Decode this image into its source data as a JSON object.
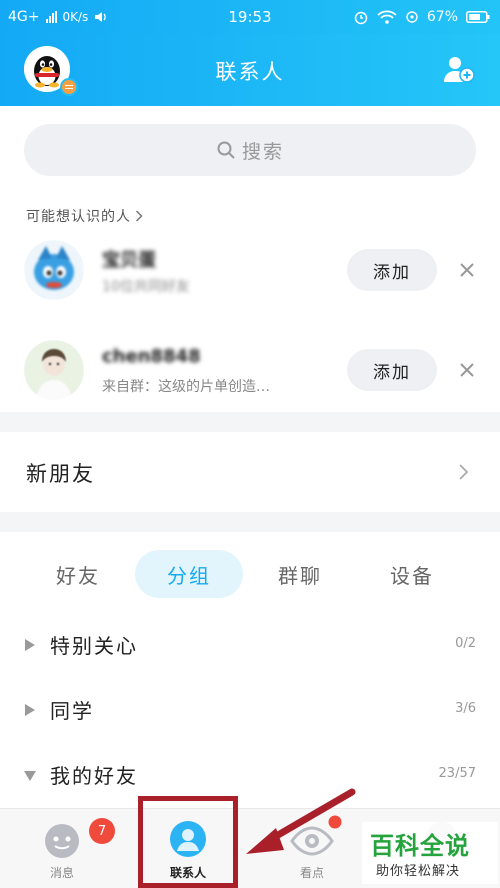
{
  "status_bar": {
    "network": "4G+",
    "speed": "0K/s",
    "time": "19:53",
    "battery": "67%"
  },
  "header": {
    "title": "联系人"
  },
  "search": {
    "placeholder": "搜索"
  },
  "suggestions": {
    "title": "可能想认识的人",
    "items": [
      {
        "name": "宝贝蛋",
        "desc": "10位共同好友",
        "desc_blurred": true,
        "add_label": "添加"
      },
      {
        "name": "chen8848",
        "desc": "来自群：这级的片单创造…",
        "desc_blurred": false,
        "add_label": "添加"
      }
    ]
  },
  "new_friends": {
    "label": "新朋友"
  },
  "tabs": [
    {
      "label": "好友",
      "active": false
    },
    {
      "label": "分组",
      "active": true
    },
    {
      "label": "群聊",
      "active": false
    },
    {
      "label": "设备",
      "active": false
    }
  ],
  "groups": [
    {
      "name": "特别关心",
      "count": "0/2",
      "expanded": false
    },
    {
      "name": "同学",
      "count": "3/6",
      "expanded": false
    },
    {
      "name": "我的好友",
      "count": "23/57",
      "expanded": true
    }
  ],
  "tabbar": {
    "items": [
      {
        "label": "消息",
        "icon": "message-icon",
        "badge": "7"
      },
      {
        "label": "联系人",
        "icon": "contacts-icon",
        "active": true
      },
      {
        "label": "看点",
        "icon": "eye-icon",
        "dot": true
      },
      {
        "label": "",
        "icon": "star-icon"
      }
    ]
  },
  "annotation": {
    "color": "#a9202b"
  },
  "watermark": {
    "logo": "百科全说",
    "sub": "助你轻松解决"
  },
  "colors": {
    "header": "#14a9f5",
    "accent": "#17a9ee",
    "badge": "#ef4a3c",
    "watermark": "#25a33d"
  }
}
